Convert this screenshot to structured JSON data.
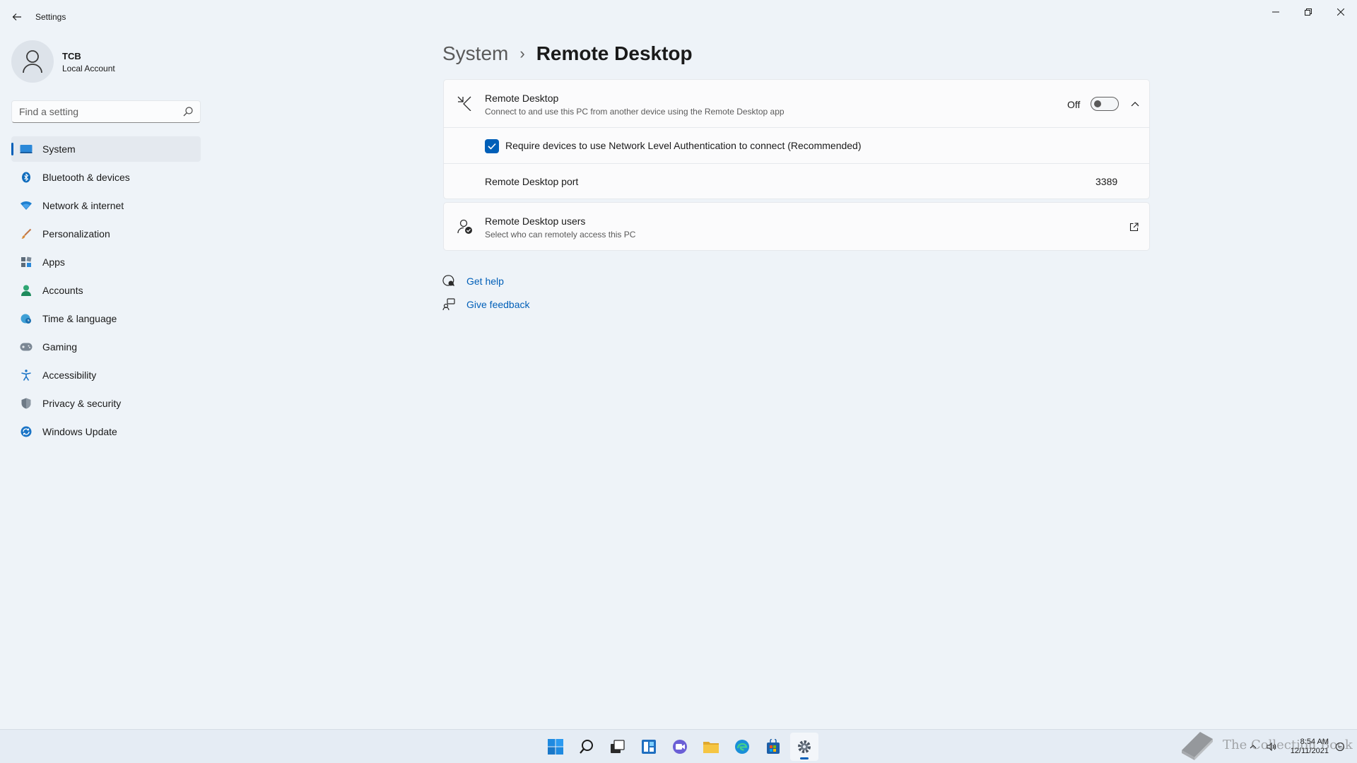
{
  "window": {
    "app_title": "Settings"
  },
  "profile": {
    "name": "TCB",
    "account_type": "Local Account"
  },
  "search": {
    "placeholder": "Find a setting",
    "value": ""
  },
  "sidebar": {
    "items": [
      {
        "label": "System",
        "icon": "monitor-icon",
        "active": true
      },
      {
        "label": "Bluetooth & devices",
        "icon": "bluetooth-icon"
      },
      {
        "label": "Network & internet",
        "icon": "wifi-icon"
      },
      {
        "label": "Personalization",
        "icon": "brush-icon"
      },
      {
        "label": "Apps",
        "icon": "apps-icon"
      },
      {
        "label": "Accounts",
        "icon": "person-icon"
      },
      {
        "label": "Time & language",
        "icon": "globe-clock-icon"
      },
      {
        "label": "Gaming",
        "icon": "gamepad-icon"
      },
      {
        "label": "Accessibility",
        "icon": "accessibility-icon"
      },
      {
        "label": "Privacy & security",
        "icon": "shield-icon"
      },
      {
        "label": "Windows Update",
        "icon": "update-icon"
      }
    ]
  },
  "breadcrumb": {
    "parent": "System",
    "separator": "›",
    "current": "Remote Desktop"
  },
  "remote_desktop": {
    "title": "Remote Desktop",
    "description": "Connect to and use this PC from another device using the Remote Desktop app",
    "toggle_state_label": "Off",
    "enabled": false,
    "expanded": true,
    "nla_label": "Require devices to use Network Level Authentication to connect (Recommended)",
    "nla_checked": true,
    "port_label": "Remote Desktop port",
    "port_value": "3389"
  },
  "remote_users": {
    "title": "Remote Desktop users",
    "description": "Select who can remotely access this PC"
  },
  "help": {
    "get_help": "Get help",
    "give_feedback": "Give feedback"
  },
  "taskbar": {
    "apps": [
      "start-icon",
      "search-icon",
      "task-view-icon",
      "widgets-icon",
      "chat-icon",
      "file-explorer-icon",
      "edge-icon",
      "store-icon",
      "settings-icon"
    ],
    "active_app": "settings-icon",
    "time": "8:54 AM",
    "date": "12/11/2021"
  },
  "watermark": {
    "text": "The Collection Book"
  },
  "colors": {
    "accent": "#005fb8",
    "background": "#eef3f8",
    "card": "#fbfbfc"
  }
}
